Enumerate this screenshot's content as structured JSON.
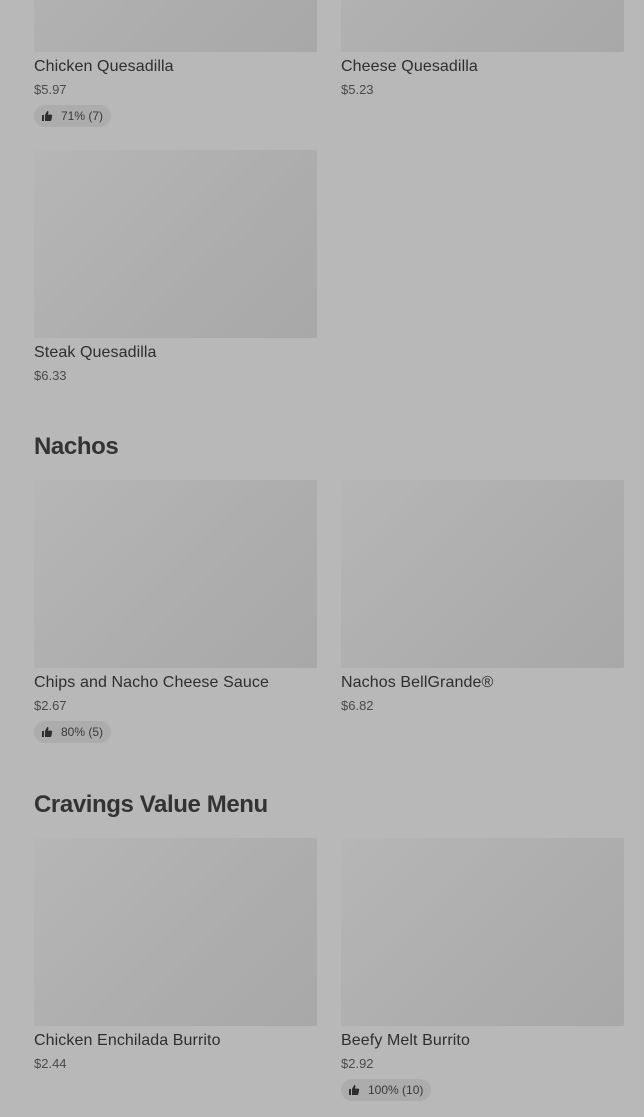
{
  "sections": {
    "quesadillas": {
      "items": [
        {
          "name": "Chicken Quesadilla",
          "price": "$5.97",
          "rating": "71% (7)"
        },
        {
          "name": "Cheese Quesadilla",
          "price": "$5.23"
        },
        {
          "name": "Steak Quesadilla",
          "price": "$6.33"
        }
      ]
    },
    "nachos": {
      "title": "Nachos",
      "items": [
        {
          "name": "Chips and Nacho Cheese Sauce",
          "price": "$2.67",
          "rating": "80% (5)"
        },
        {
          "name": "Nachos BellGrande®",
          "price": "$6.82"
        }
      ]
    },
    "cravings": {
      "title": "Cravings Value Menu",
      "items": [
        {
          "name": "Chicken Enchilada Burrito",
          "price": "$2.44"
        },
        {
          "name": "Beefy Melt Burrito",
          "price": "$2.92",
          "rating": "100% (10)"
        }
      ]
    }
  },
  "icons": {
    "rating": "thumbs-up-icon"
  },
  "colors": {
    "background": "#b8b8b8",
    "thumbnail": "#adadad",
    "text": "#2e2e2e",
    "rating_pill": "#acacac"
  }
}
